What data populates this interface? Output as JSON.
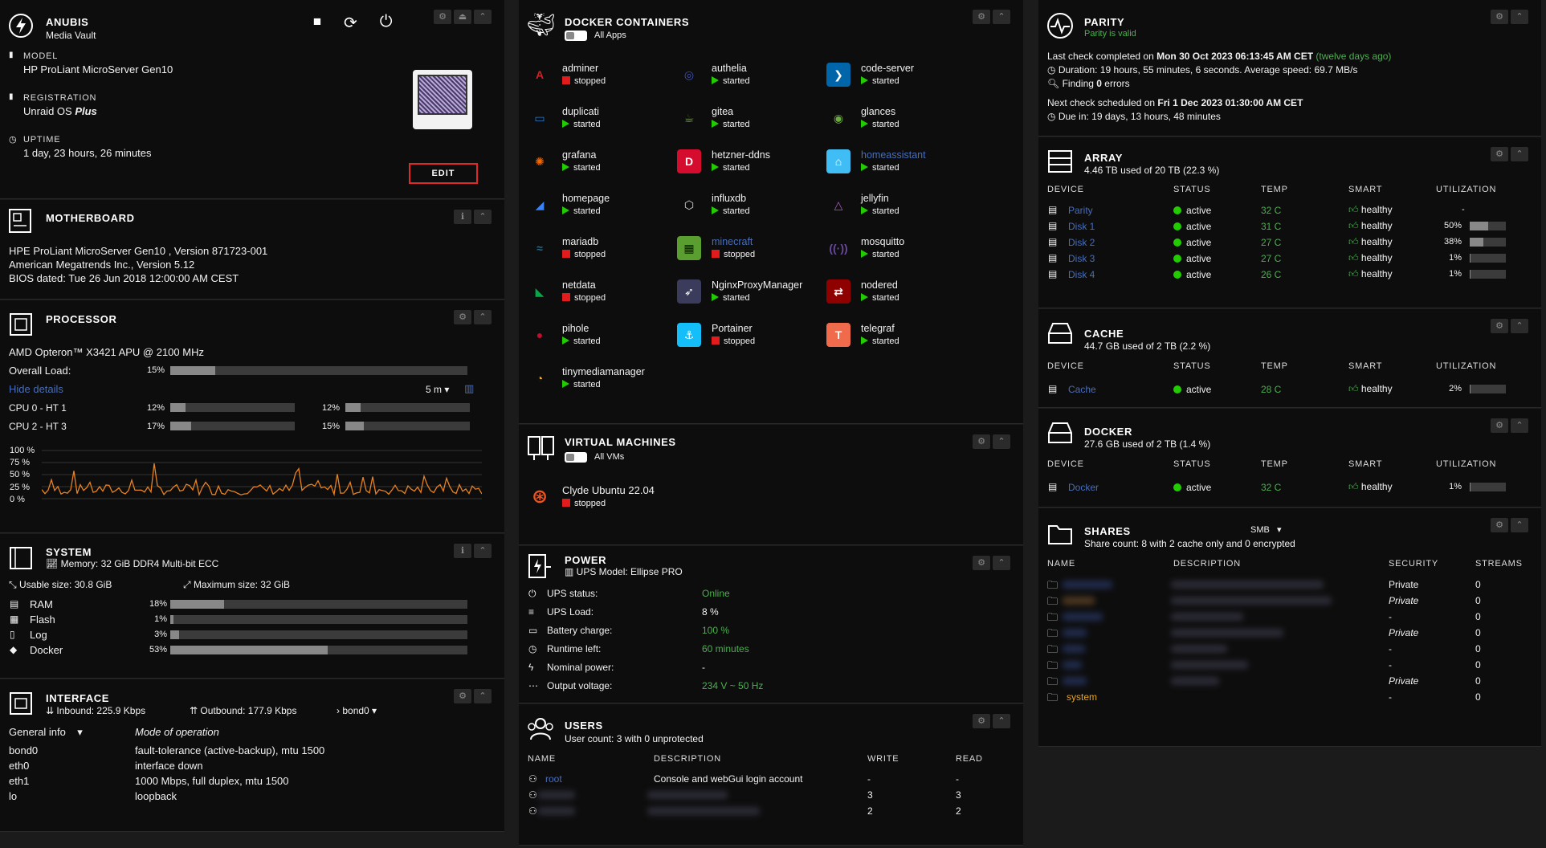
{
  "server": {
    "name": "ANUBIS",
    "desc": "Media Vault",
    "model_label": "MODEL",
    "model": "HP ProLiant MicroServer Gen10",
    "reg_label": "REGISTRATION",
    "reg_prefix": "Unraid OS ",
    "reg_plan": "Plus",
    "uptime_label": "UPTIME",
    "uptime": "1 day, 23 hours, 26 minutes",
    "edit": "EDIT"
  },
  "motherboard": {
    "title": "MOTHERBOARD",
    "line1": "HPE ProLiant MicroServer Gen10 , Version 871723-001",
    "line2": "American Megatrends Inc., Version 5.12",
    "line3": "BIOS dated: Tue 26 Jun 2018 12:00:00 AM CEST"
  },
  "processor": {
    "title": "PROCESSOR",
    "cpu": "AMD Opteron™ X3421 APU @ 2100 MHz",
    "overall_label": "Overall Load:",
    "overall": "15%",
    "overall_pct": 15,
    "hide": "Hide details",
    "interval": "5 m",
    "cores": [
      {
        "label": "CPU 0 - HT 1",
        "a": "12%",
        "ap": 12,
        "b": "12%",
        "bp": 12
      },
      {
        "label": "CPU 2 - HT 3",
        "a": "17%",
        "ap": 17,
        "b": "15%",
        "bp": 15
      }
    ],
    "yticks": [
      "100 %",
      "75 %",
      "50 %",
      "25 %",
      "0 %"
    ]
  },
  "system": {
    "title": "SYSTEM",
    "memory": "Memory: 32 GiB DDR4 Multi-bit ECC",
    "usable": "Usable size: 30.8 GiB",
    "maximum": "Maximum size: 32 GiB",
    "rows": [
      {
        "label": "RAM",
        "val": "18%",
        "pct": 18
      },
      {
        "label": "Flash",
        "val": "1%",
        "pct": 1
      },
      {
        "label": "Log",
        "val": "3%",
        "pct": 3
      },
      {
        "label": "Docker",
        "val": "53%",
        "pct": 53
      }
    ]
  },
  "interface": {
    "title": "INTERFACE",
    "inbound": "Inbound: 225.9 Kbps",
    "outbound": "Outbound: 177.9 Kbps",
    "bond": "bond0",
    "general": "General info",
    "mode_header": "Mode of operation",
    "rows": [
      {
        "name": "bond0",
        "info": "fault-tolerance (active-backup), mtu 1500"
      },
      {
        "name": "eth0",
        "info": "interface down"
      },
      {
        "name": "eth1",
        "info": "1000 Mbps, full duplex, mtu 1500"
      },
      {
        "name": "lo",
        "info": "loopback"
      }
    ]
  },
  "docker": {
    "title": "DOCKER CONTAINERS",
    "sub": "All Apps",
    "containers": [
      {
        "name": "adminer",
        "state": "stopped",
        "icon": "A",
        "bg": "#0d0d0d",
        "fg": "#cc2222",
        "link": false
      },
      {
        "name": "authelia",
        "state": "started",
        "icon": "◎",
        "bg": "#0d0d0d",
        "fg": "#3f51b5",
        "link": false
      },
      {
        "name": "code-server",
        "state": "started",
        "icon": "❯",
        "bg": "#0065a9",
        "fg": "#fff",
        "link": false
      },
      {
        "name": "duplicati",
        "state": "started",
        "icon": "▭",
        "bg": "#0d0d0d",
        "fg": "#2a7cc9",
        "link": false
      },
      {
        "name": "gitea",
        "state": "started",
        "icon": "☕",
        "bg": "#0d0d0d",
        "fg": "#609926",
        "link": false
      },
      {
        "name": "glances",
        "state": "started",
        "icon": "◉",
        "bg": "#0d0d0d",
        "fg": "#6cab3f",
        "link": false
      },
      {
        "name": "grafana",
        "state": "started",
        "icon": "✺",
        "bg": "#0d0d0d",
        "fg": "#f46800",
        "link": false
      },
      {
        "name": "hetzner-ddns",
        "state": "started",
        "icon": "D",
        "bg": "#d50c2d",
        "fg": "#fff",
        "link": false
      },
      {
        "name": "homeassistant",
        "state": "started",
        "icon": "⌂",
        "bg": "#41bdf5",
        "fg": "#fff",
        "link": true
      },
      {
        "name": "homepage",
        "state": "started",
        "icon": "◢",
        "bg": "#0d0d0d",
        "fg": "#3b82f6",
        "link": false
      },
      {
        "name": "influxdb",
        "state": "started",
        "icon": "⬡",
        "bg": "#0d0d0d",
        "fg": "#ddd",
        "link": false
      },
      {
        "name": "jellyfin",
        "state": "started",
        "icon": "△",
        "bg": "#0d0d0d",
        "fg": "#aa5cc3",
        "link": false
      },
      {
        "name": "mariadb",
        "state": "stopped",
        "icon": "≈",
        "bg": "#0d0d0d",
        "fg": "#1f6d8f",
        "link": false
      },
      {
        "name": "minecraft",
        "state": "stopped",
        "icon": "▦",
        "bg": "#5a9e2f",
        "fg": "#111",
        "link": true
      },
      {
        "name": "mosquitto",
        "state": "started",
        "icon": "((·))",
        "bg": "#0d0d0d",
        "fg": "#6a4a9c",
        "link": false
      },
      {
        "name": "netdata",
        "state": "stopped",
        "icon": "◣",
        "bg": "#0d0d0d",
        "fg": "#00ab44",
        "link": false
      },
      {
        "name": "NginxProxyManager",
        "state": "started",
        "icon": "➶",
        "bg": "#3b3b5c",
        "fg": "#fff",
        "link": false
      },
      {
        "name": "nodered",
        "state": "started",
        "icon": "⇄",
        "bg": "#8f0000",
        "fg": "#fff",
        "link": false
      },
      {
        "name": "pihole",
        "state": "started",
        "icon": "●",
        "bg": "#0d0d0d",
        "fg": "#c40d2e",
        "link": false
      },
      {
        "name": "Portainer",
        "state": "stopped",
        "icon": "⚓",
        "bg": "#13bef9",
        "fg": "#fff",
        "link": false
      },
      {
        "name": "telegraf",
        "state": "started",
        "icon": "T",
        "bg": "#f06a4c",
        "fg": "#fff",
        "link": false
      },
      {
        "name": "tinymediamanager",
        "state": "started",
        "icon": "◔",
        "bg": "#0d0d0d",
        "fg": "#f5a623",
        "link": false
      }
    ]
  },
  "vms": {
    "title": "VIRTUAL MACHINES",
    "sub": "All VMs",
    "vm_name": "Clyde Ubuntu 22.04",
    "vm_state": "stopped"
  },
  "power": {
    "title": "POWER",
    "model": "UPS Model: Ellipse PRO",
    "rows": [
      {
        "label": "UPS status:",
        "val": "Online",
        "green": true
      },
      {
        "label": "UPS Load:",
        "val": "8 %",
        "green": false
      },
      {
        "label": "Battery charge:",
        "val": "100 %",
        "green": true
      },
      {
        "label": "Runtime left:",
        "val": "60 minutes",
        "green": true
      },
      {
        "label": "Nominal power:",
        "val": "-",
        "green": false
      },
      {
        "label": "Output voltage:",
        "val": "234 V ~ 50 Hz",
        "green": true
      }
    ]
  },
  "users": {
    "title": "USERS",
    "sub": "User count: 3 with 0 unprotected",
    "headers": [
      "NAME",
      "DESCRIPTION",
      "WRITE",
      "READ"
    ],
    "rows": [
      {
        "name": "root",
        "desc": "Console and webGui login account",
        "write": "-",
        "read": "-"
      },
      {
        "name": "",
        "desc": "",
        "write": "3",
        "read": "3"
      },
      {
        "name": "",
        "desc": "",
        "write": "2",
        "read": "2"
      }
    ]
  },
  "parity": {
    "title": "PARITY",
    "valid": "Parity is valid",
    "last_prefix": "Last check completed on ",
    "last_date": "Mon 30 Oct 2023 06:13:45 AM CET",
    "last_ago": " (twelve days ago)",
    "duration": "Duration: 19 hours, 55 minutes, 6 seconds. Average speed: 69.7 MB/s",
    "finding_pre": "Finding ",
    "finding_num": "0",
    "finding_post": " errors",
    "next_prefix": "Next check scheduled on ",
    "next_date": "Fri 1 Dec 2023 01:30:00 AM CET",
    "due": "Due in: 19 days, 13 hours, 48 minutes"
  },
  "array": {
    "title": "ARRAY",
    "sub": "4.46 TB used of 20 TB (22.3 %)",
    "headers": [
      "DEVICE",
      "STATUS",
      "TEMP",
      "SMART",
      "UTILIZATION"
    ],
    "rows": [
      {
        "dev": "Parity",
        "status": "active",
        "temp": "32 C",
        "smart": "healthy",
        "util": "-",
        "pct": null
      },
      {
        "dev": "Disk 1",
        "status": "active",
        "temp": "31 C",
        "smart": "healthy",
        "util": "50%",
        "pct": 50
      },
      {
        "dev": "Disk 2",
        "status": "active",
        "temp": "27 C",
        "smart": "healthy",
        "util": "38%",
        "pct": 38
      },
      {
        "dev": "Disk 3",
        "status": "active",
        "temp": "27 C",
        "smart": "healthy",
        "util": "1%",
        "pct": 1
      },
      {
        "dev": "Disk 4",
        "status": "active",
        "temp": "26 C",
        "smart": "healthy",
        "util": "1%",
        "pct": 1
      }
    ]
  },
  "cache": {
    "title": "CACHE",
    "sub": "44.7 GB used of 2 TB (2.2 %)",
    "dev": "Cache",
    "status": "active",
    "temp": "28 C",
    "smart": "healthy",
    "util": "2%",
    "pct": 2
  },
  "dockerpool": {
    "title": "DOCKER",
    "sub": "27.6 GB used of 2 TB (1.4 %)",
    "dev": "Docker",
    "status": "active",
    "temp": "32 C",
    "smart": "healthy",
    "util": "1%",
    "pct": 1
  },
  "shares": {
    "title": "SHARES",
    "smb": "SMB",
    "sub": "Share count: 8 with 2 cache only and 0 encrypted",
    "headers": [
      "NAME",
      "DESCRIPTION",
      "SECURITY",
      "STREAMS"
    ],
    "rows": [
      {
        "name": "",
        "sec": "Private",
        "italic": false,
        "streams": "0"
      },
      {
        "name": "",
        "sec": "Private",
        "italic": true,
        "streams": "0"
      },
      {
        "name": "",
        "sec": "-",
        "italic": false,
        "streams": "0"
      },
      {
        "name": "",
        "sec": "Private",
        "italic": true,
        "streams": "0"
      },
      {
        "name": "",
        "sec": "-",
        "italic": false,
        "streams": "0"
      },
      {
        "name": "",
        "sec": "-",
        "italic": false,
        "streams": "0"
      },
      {
        "name": "",
        "sec": "Private",
        "italic": true,
        "streams": "0"
      },
      {
        "name": "system",
        "sec": "-",
        "italic": false,
        "streams": "0"
      }
    ]
  }
}
